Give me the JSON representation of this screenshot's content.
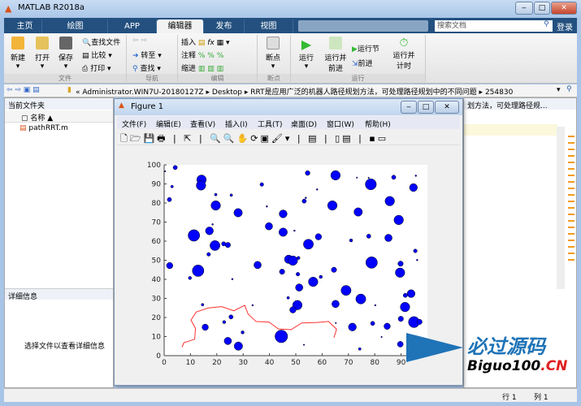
{
  "window": {
    "title": "MATLAB R2018a",
    "minimize": "‒",
    "maximize": "□",
    "close": "✕"
  },
  "tabs": [
    {
      "label": "主页"
    },
    {
      "label": "绘图"
    },
    {
      "label": "APP"
    },
    {
      "label": "编辑器"
    },
    {
      "label": "发布"
    },
    {
      "label": "视图"
    }
  ],
  "search": {
    "placeholder": "搜索文档"
  },
  "login": "登录",
  "ribbon": {
    "file": {
      "new": "新建",
      "open": "打开",
      "save": "保存",
      "find_files": "查找文件",
      "compare": "比较",
      "print": "打印",
      "group": "文件"
    },
    "nav": {
      "goto": "转至",
      "find": "查找",
      "group": "导航"
    },
    "edit": {
      "insert": "插入",
      "comment": "注释",
      "indent": "缩进",
      "group": "编辑",
      "fx": "fx"
    },
    "breakpoints": {
      "label": "断点",
      "group": "断点"
    },
    "run": {
      "run": "运行",
      "run_advance": "运行并\n前进",
      "run_section": "运行节",
      "advance": "前进",
      "run_time": "运行并\n计时",
      "group": "运行"
    }
  },
  "address": {
    "parts": [
      "«",
      "Administrator.WIN7U-20180127Z",
      "▸",
      "Desktop",
      "▸",
      "RRT是应用广泛的机器人路径规划方法，可处理路径规划中的不同问题",
      "▸",
      "254830"
    ]
  },
  "current_folder": {
    "title": "当前文件夹",
    "column": "名称 ▲",
    "files": [
      "pathRRT.m"
    ]
  },
  "details": {
    "title": "详细信息",
    "message": "选择文件以查看详细信息"
  },
  "editor_tab": "划方法，可处理路径规...",
  "figure": {
    "title": "Figure 1",
    "menu": [
      "文件(F)",
      "编辑(E)",
      "查看(V)",
      "插入(I)",
      "工具(T)",
      "桌面(D)",
      "窗口(W)",
      "帮助(H)"
    ]
  },
  "status": {
    "row_label": "行",
    "row": "1",
    "col_label": "列",
    "col": "1"
  },
  "watermark": {
    "cn": "必过源码",
    "en": "Biguo100",
    ".cn": ".CN"
  },
  "chart_data": {
    "type": "scatter",
    "xlim": [
      0,
      100
    ],
    "ylim": [
      0,
      100
    ],
    "xticks": [
      0,
      10,
      20,
      30,
      40,
      50,
      60,
      70,
      80,
      90
    ],
    "yticks": [
      0,
      10,
      20,
      30,
      40,
      50,
      60,
      70,
      80,
      90,
      100
    ],
    "obstacle_color": "#0000ff",
    "path_color": "#ff3030",
    "obstacles": [
      [
        4.2,
        98.6,
        0.8
      ],
      [
        54.5,
        95.7,
        0.9
      ],
      [
        65.1,
        94.5,
        1.8
      ],
      [
        14.2,
        92.2,
        1.8
      ],
      [
        14,
        89.2,
        1.8
      ],
      [
        78.5,
        89.8,
        2.1
      ],
      [
        87.2,
        93.5,
        0.8
      ],
      [
        94.7,
        88.1,
        1.5
      ],
      [
        3,
        88.6,
        0.5
      ],
      [
        37.1,
        89.7,
        0.7
      ],
      [
        2,
        81.8,
        0.8
      ],
      [
        19.6,
        84.4,
        0.5
      ],
      [
        25.5,
        84.1,
        0.5
      ],
      [
        19.6,
        78.7,
        1.8
      ],
      [
        28.1,
        74.9,
        1.6
      ],
      [
        53.2,
        81,
        0.8
      ],
      [
        63.9,
        78.7,
        1.8
      ],
      [
        85.7,
        81,
        1.8
      ],
      [
        73.7,
        75.3,
        1.6
      ],
      [
        45.2,
        74.3,
        1.5
      ],
      [
        89.1,
        71.1,
        1.8
      ],
      [
        39.8,
        67.8,
        1.4
      ],
      [
        17.2,
        65.4,
        1.5
      ],
      [
        11.3,
        63,
        2.2
      ],
      [
        45.2,
        64.7,
        1.6
      ],
      [
        58.6,
        62.3,
        1.2
      ],
      [
        77.7,
        62.6,
        0.8
      ],
      [
        85.2,
        61.7,
        1.4
      ],
      [
        71,
        60.4,
        0.6
      ],
      [
        54.8,
        58.4,
        1.9
      ],
      [
        19.3,
        57.7,
        1.9
      ],
      [
        22.6,
        58.6,
        0.8
      ],
      [
        24.2,
        58,
        1
      ],
      [
        16.9,
        53.1,
        0.7
      ],
      [
        95.4,
        54.9,
        0.7
      ],
      [
        18.4,
        68.8,
        0.3
      ],
      [
        39,
        78.2,
        0.3
      ],
      [
        58.1,
        87.1,
        0.3
      ],
      [
        53.8,
        82.7,
        0.3
      ],
      [
        49.5,
        65.5,
        0.3
      ],
      [
        95.6,
        94.3,
        0.3
      ],
      [
        73.2,
        93.3,
        0.2
      ],
      [
        77.7,
        93.2,
        0.2
      ],
      [
        0.4,
        96.6,
        0.2
      ],
      [
        47.3,
        50.5,
        1.6
      ],
      [
        48.9,
        49.8,
        1.8
      ],
      [
        51,
        51.2,
        0.6
      ],
      [
        2.1,
        47.2,
        1.2
      ],
      [
        12.9,
        44.5,
        2.2
      ],
      [
        35.5,
        47.5,
        1.4
      ],
      [
        78.8,
        48.8,
        2.2
      ],
      [
        89.8,
        48.2,
        1
      ],
      [
        89.6,
        43.5,
        1.8
      ],
      [
        44.8,
        44,
        1
      ],
      [
        50.8,
        42.7,
        0.7
      ],
      [
        64.5,
        45,
        1
      ],
      [
        59.5,
        41.3,
        0.6
      ],
      [
        9.8,
        40.7,
        0.6
      ],
      [
        56.6,
        38.7,
        1.8
      ],
      [
        51.3,
        35.7,
        1.4
      ],
      [
        69.1,
        34.2,
        1.9
      ],
      [
        74.7,
        29.7,
        1.9
      ],
      [
        93.8,
        32.5,
        1.5
      ],
      [
        91.6,
        31.6,
        0.8
      ],
      [
        47.1,
        30.3,
        0.5
      ],
      [
        50.6,
        26.5,
        1.8
      ],
      [
        48.9,
        24,
        1.2
      ],
      [
        65.1,
        27.1,
        1.4
      ],
      [
        91.5,
        25.5,
        1.8
      ],
      [
        14.6,
        26.7,
        0.5
      ],
      [
        25.4,
        20.3,
        0.8
      ],
      [
        22.8,
        17.6,
        0.6
      ],
      [
        15.6,
        14.9,
        1.2
      ],
      [
        71.5,
        15,
        1.5
      ],
      [
        79.2,
        16.9,
        0.8
      ],
      [
        84.7,
        15.4,
        1.2
      ],
      [
        89.9,
        19.3,
        1
      ],
      [
        94.9,
        17.6,
        2.1
      ],
      [
        97,
        17.7,
        1
      ],
      [
        44.5,
        10.1,
        2.4
      ],
      [
        29.8,
        12.2,
        0.6
      ],
      [
        24.2,
        7.7,
        1.4
      ],
      [
        28.2,
        5,
        1.6
      ],
      [
        89.7,
        6,
        1.1
      ],
      [
        74.3,
        3.5,
        0.5
      ],
      [
        53.1,
        5.7,
        0.2
      ],
      [
        65.2,
        17.1,
        0.2
      ],
      [
        33.6,
        26.4,
        0.3
      ],
      [
        80.2,
        26.4,
        0.3
      ],
      [
        25.9,
        40.1,
        0.3
      ],
      [
        82.6,
        9.8,
        0.2
      ],
      [
        96.1,
        50.1,
        0.3
      ]
    ],
    "path": [
      [
        6.8,
        4.4
      ],
      [
        7.5,
        6.8
      ],
      [
        11.6,
        8.6
      ],
      [
        11.9,
        14.3
      ],
      [
        10.2,
        18.6
      ],
      [
        12.2,
        22.9
      ],
      [
        16.8,
        25
      ],
      [
        21.9,
        25.7
      ],
      [
        26.5,
        23.5
      ],
      [
        30.6,
        26.4
      ],
      [
        31.9,
        21.8
      ],
      [
        34.9,
        17.9
      ],
      [
        39.8,
        17.6
      ],
      [
        43.4,
        14
      ],
      [
        48.2,
        13.6
      ],
      [
        52.2,
        17.1
      ],
      [
        58.1,
        17.4
      ],
      [
        62.4,
        17.9
      ],
      [
        65.5,
        13.9
      ],
      [
        64.5,
        9.4
      ]
    ]
  }
}
